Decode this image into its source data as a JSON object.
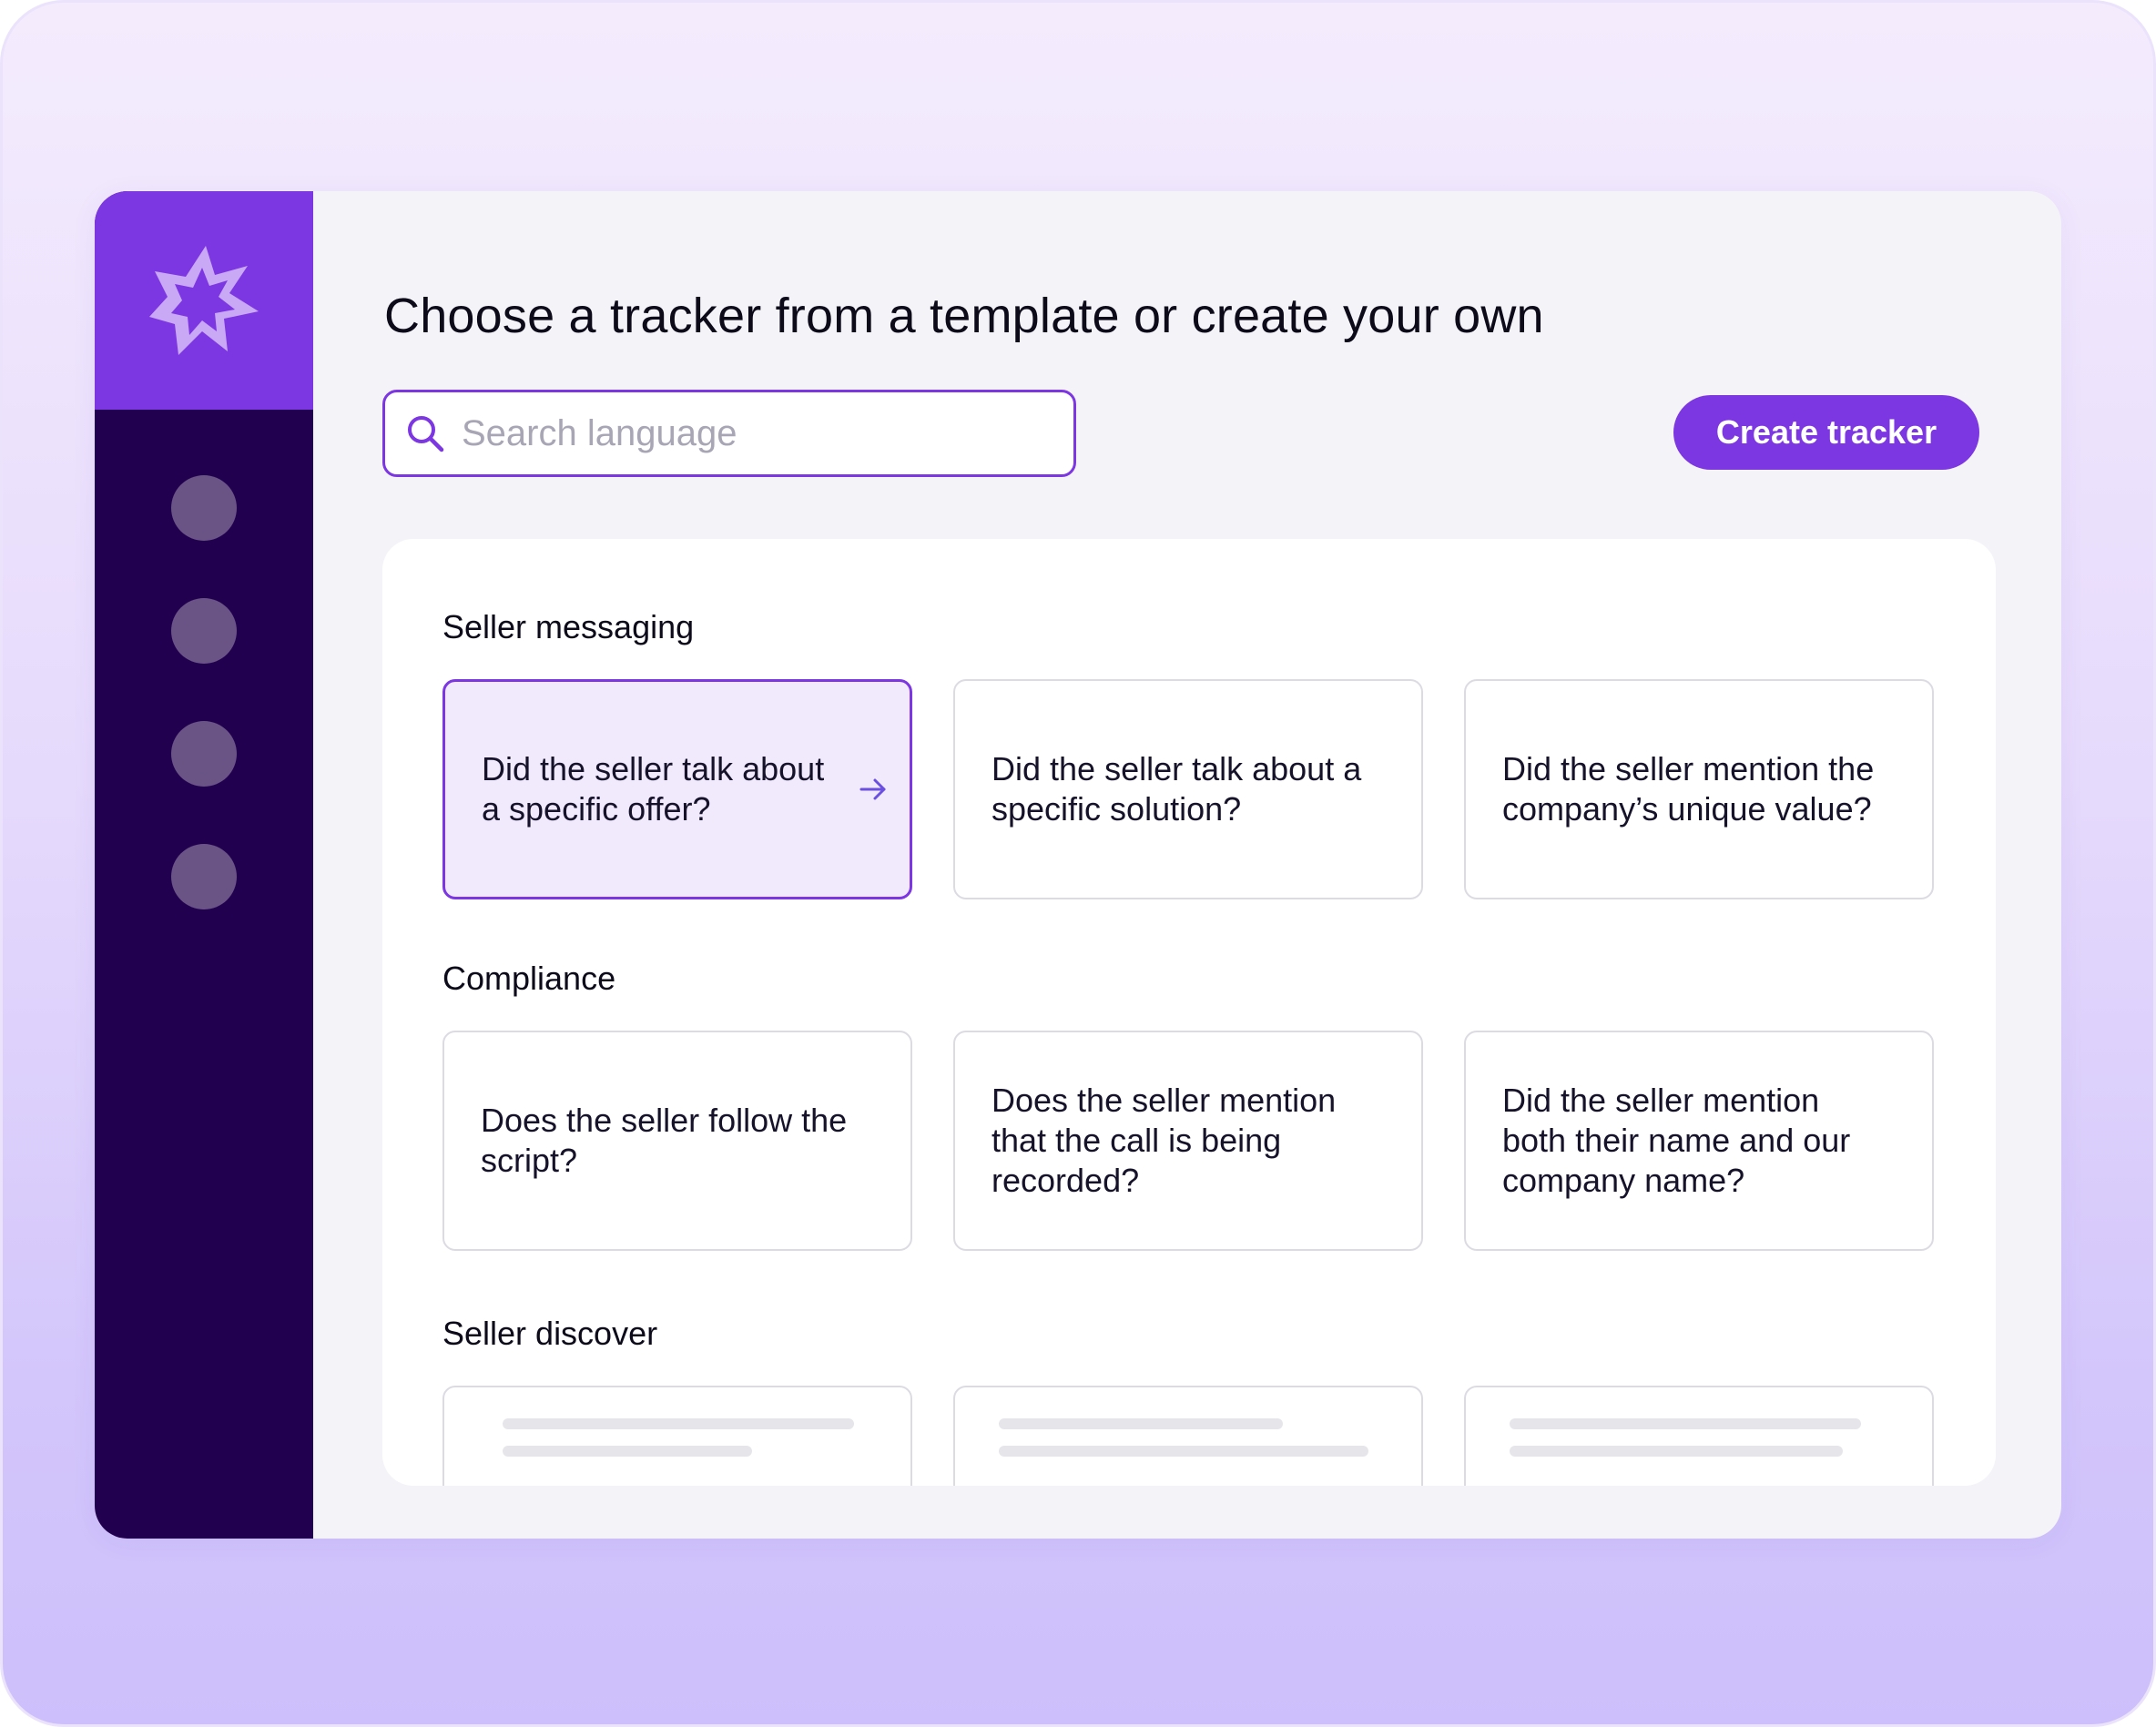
{
  "page": {
    "title": "Choose a tracker from a template or create your own"
  },
  "search": {
    "placeholder": "Search language",
    "value": ""
  },
  "actions": {
    "create_label": "Create tracker"
  },
  "sections": [
    {
      "title": "Seller messaging",
      "cards": [
        {
          "text": "Did the seller talk about a specific offer?",
          "selected": true
        },
        {
          "text": "Did the seller talk about a specific solution?",
          "selected": false
        },
        {
          "text": "Did the seller mention the company’s unique value?",
          "selected": false
        }
      ]
    },
    {
      "title": "Compliance",
      "cards": [
        {
          "text": "Does the seller follow the script?",
          "selected": false
        },
        {
          "text": "Does the seller mention that the call is being recorded?",
          "selected": false
        },
        {
          "text": "Did the seller mention both their name and our company name?",
          "selected": false
        }
      ]
    },
    {
      "title": "Seller discover",
      "cards": []
    }
  ],
  "icons": {
    "logo": "starburst-logo-icon",
    "search": "search-icon",
    "arrow": "arrow-right-icon"
  },
  "colors": {
    "accent": "#7c36e2",
    "sidebar": "#20004f",
    "nav_dot": "#6a5385",
    "selected_card": "#f1eafd"
  }
}
